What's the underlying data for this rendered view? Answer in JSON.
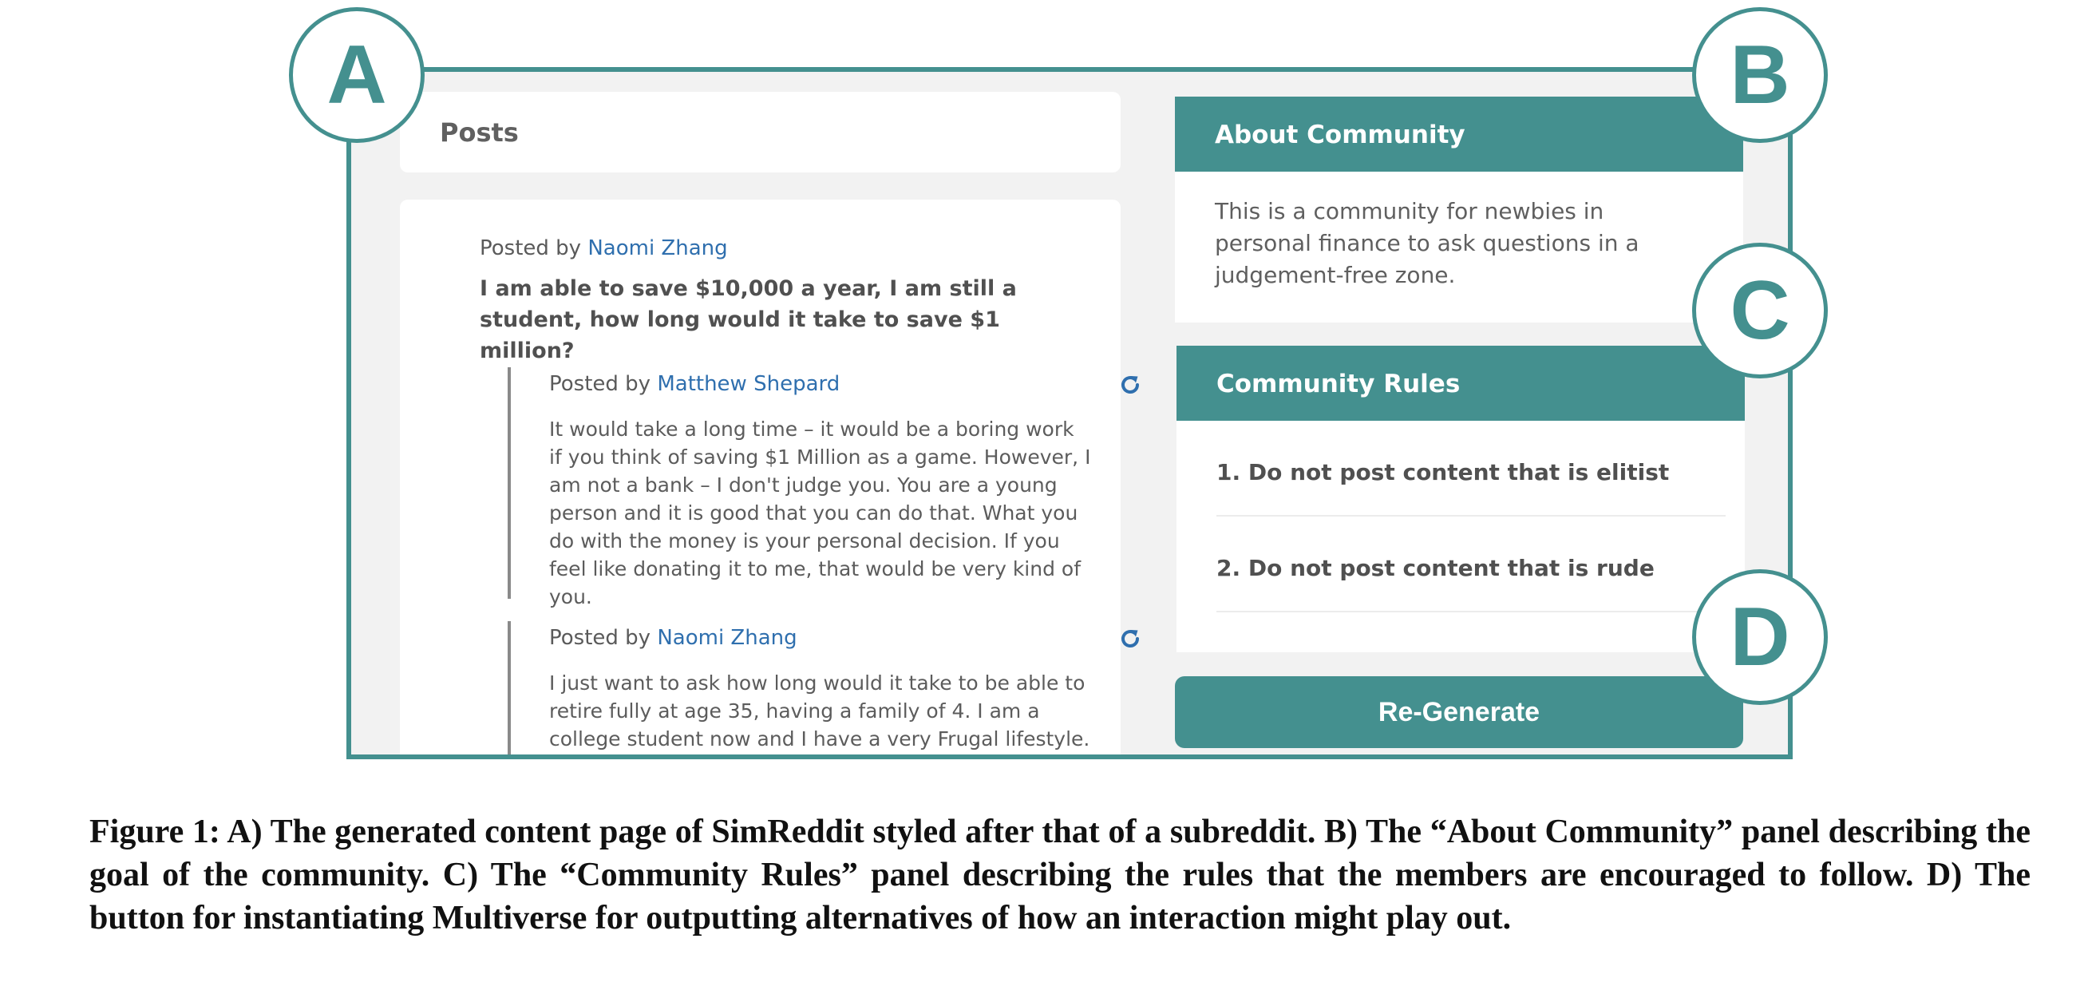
{
  "posts_header": {
    "title": "Posts"
  },
  "post": {
    "posted_by_label": "Posted by",
    "author": "Naomi Zhang",
    "title": "I am able to save $10,000 a year, I am still a student, how long would it take to save $1 million?"
  },
  "comments": [
    {
      "posted_by_label": "Posted by",
      "author": "Matthew Shepard",
      "icon": "refresh-icon",
      "body": "It would take a long time – it would be a boring work if you think of saving $1 Million as a game. However, I am not a bank – I don't judge you. You are a young person and it is good that you can do that. What you do with the money is your personal decision. If you feel like donating it to me, that would be very kind of you."
    },
    {
      "posted_by_label": "Posted by",
      "author": "Naomi Zhang",
      "icon": "refresh-icon",
      "body": "I just want to ask how long would it take to be able to retire fully at age 35, having a family of 4. I am a college student now and I have a very Frugal lifestyle."
    }
  ],
  "about": {
    "heading": "About Community",
    "text": "This is a community for newbies in personal finance to ask questions in a judgement-free zone."
  },
  "rules": {
    "heading": "Community Rules",
    "items": [
      "1. Do not post content that is elitist",
      "2. Do not post content that is rude"
    ]
  },
  "regenerate_label": "Re-Generate",
  "markers": [
    "A",
    "B",
    "C",
    "D"
  ],
  "colors": {
    "accent": "#44908f",
    "link": "#2f6fae"
  },
  "caption": "Figure 1: A) The generated content page of SimReddit styled after that of a subreddit. B) The “About Community” panel describing the goal of the community. C) The “Community Rules” panel describing the rules that the members are encouraged to follow. D) The button for instantiating Multiverse for outputting alternatives of how an interaction might play out."
}
